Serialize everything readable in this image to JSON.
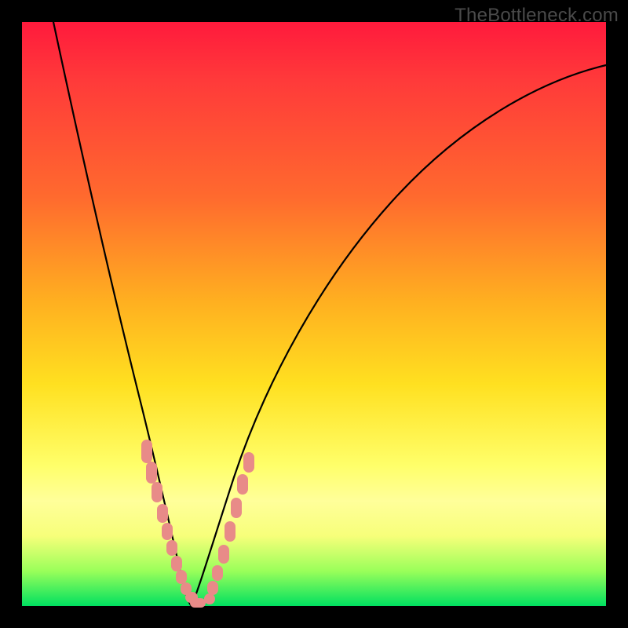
{
  "watermark": "TheBottleneck.com",
  "chart_data": {
    "type": "line",
    "title": "",
    "xlabel": "",
    "ylabel": "",
    "xlim": [
      0,
      100
    ],
    "ylim": [
      0,
      100
    ],
    "grid": false,
    "series": [
      {
        "name": "bottleneck-curve",
        "x": [
          0,
          2,
          5,
          8,
          11,
          14,
          17,
          20,
          22,
          24,
          26,
          27,
          28,
          30,
          33,
          37,
          42,
          48,
          55,
          62,
          70,
          78,
          86,
          94,
          100
        ],
        "values": [
          100,
          92,
          81,
          71,
          61,
          51,
          41,
          31,
          23,
          16,
          9,
          4,
          0,
          3,
          10,
          20,
          32,
          44,
          55,
          64,
          72,
          79,
          84,
          88,
          90
        ]
      }
    ],
    "scatter_points": {
      "name": "highlighted-values",
      "x": [
        21.0,
        21.7,
        22.5,
        23.4,
        24.1,
        24.6,
        25.2,
        25.8,
        26.4,
        27.0,
        27.6,
        28.0,
        28.6,
        29.3,
        30.2,
        31.2,
        32.3,
        33.3,
        34.4
      ],
      "values": [
        27.0,
        24.0,
        21.0,
        17.5,
        14.5,
        12.5,
        10.0,
        7.5,
        5.0,
        3.0,
        1.5,
        0.5,
        1.0,
        3.0,
        6.0,
        10.0,
        14.0,
        18.0,
        22.5
      ]
    },
    "gradient_stops": [
      {
        "pos": 0,
        "color": "#ff1a3c"
      },
      {
        "pos": 10,
        "color": "#ff3a3a"
      },
      {
        "pos": 30,
        "color": "#ff6a2e"
      },
      {
        "pos": 48,
        "color": "#ffb020"
      },
      {
        "pos": 62,
        "color": "#ffe020"
      },
      {
        "pos": 76,
        "color": "#ffff6a"
      },
      {
        "pos": 82,
        "color": "#ffff9a"
      },
      {
        "pos": 88,
        "color": "#f7ff7a"
      },
      {
        "pos": 94,
        "color": "#9aff5a"
      },
      {
        "pos": 100,
        "color": "#00e060"
      }
    ]
  }
}
